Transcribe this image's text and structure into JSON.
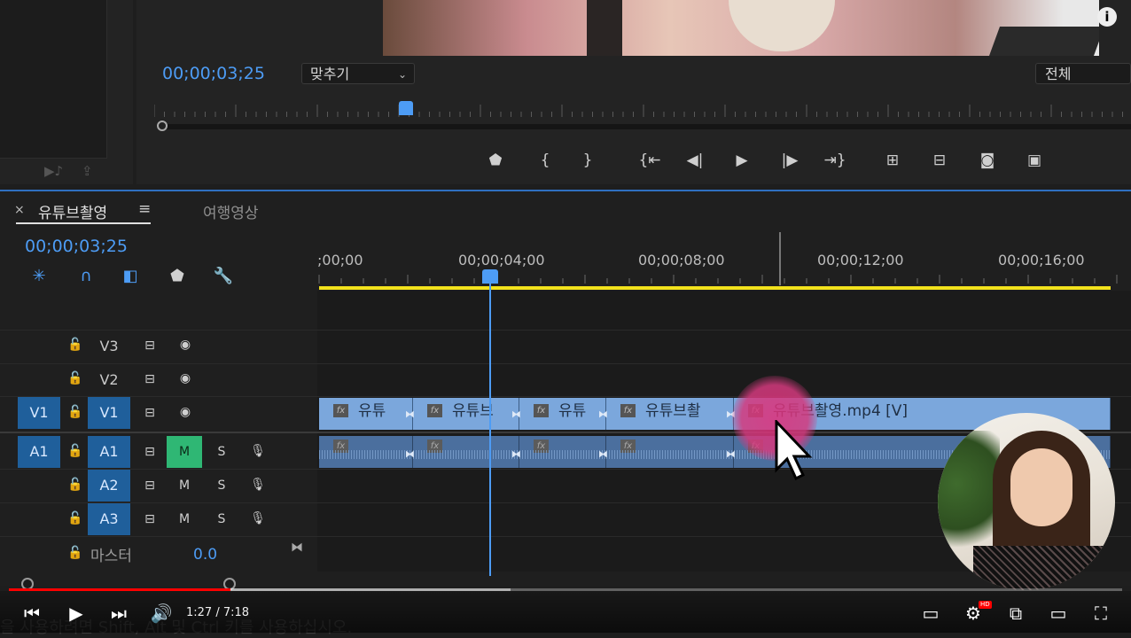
{
  "program_monitor": {
    "timecode": "00;00;03;25",
    "fit_label": "맞추기",
    "quality_label": "전체",
    "controls": [
      "marker",
      "mark-in",
      "mark-out",
      "go-to-in",
      "step-back",
      "play",
      "step-forward",
      "go-to-out",
      "lift",
      "extract",
      "export-frame",
      "comparison-view"
    ]
  },
  "timeline": {
    "tab_close": "×",
    "active_tab": "유튜브촬영",
    "tab_menu": "≡",
    "other_tab": "여행영상",
    "timecode": "00;00;03;25",
    "ruler_labels": [
      ";00;00",
      "00;00;04;00",
      "00;00;08;00",
      "00;00;12;00",
      "00;00;16;00"
    ],
    "tracks": {
      "v3": {
        "name": "V3"
      },
      "v2": {
        "name": "V2"
      },
      "v1": {
        "target": "V1",
        "name": "V1"
      },
      "a1": {
        "target": "A1",
        "name": "A1",
        "m": "M",
        "s": "S"
      },
      "a2": {
        "name": "A2",
        "m": "M",
        "s": "S"
      },
      "a3": {
        "name": "A3",
        "m": "M",
        "s": "S"
      }
    },
    "video_clips": [
      "유튜",
      "유튜브",
      "유튜",
      "유튜브촬",
      "유튜브촬영.mp4 [V]"
    ],
    "fx_label": "fx",
    "master": {
      "name": "마스터",
      "value": "0.0"
    }
  },
  "player": {
    "time": "1:27 / 7:18",
    "hd_badge": "HD",
    "progress_fraction": 0.199,
    "buffered_fraction": 0.451
  },
  "hint_text": "을 사용하려면 Shift, Alt 및 Ctrl 키를 사용하십시오.",
  "colors": {
    "accent": "#4d9cf5",
    "work_area": "#f2e21c",
    "clip_video": "#7ba7dc",
    "clip_audio": "#4b6f9e",
    "mute_on": "#2fb774",
    "yt_red": "#ff0000"
  }
}
